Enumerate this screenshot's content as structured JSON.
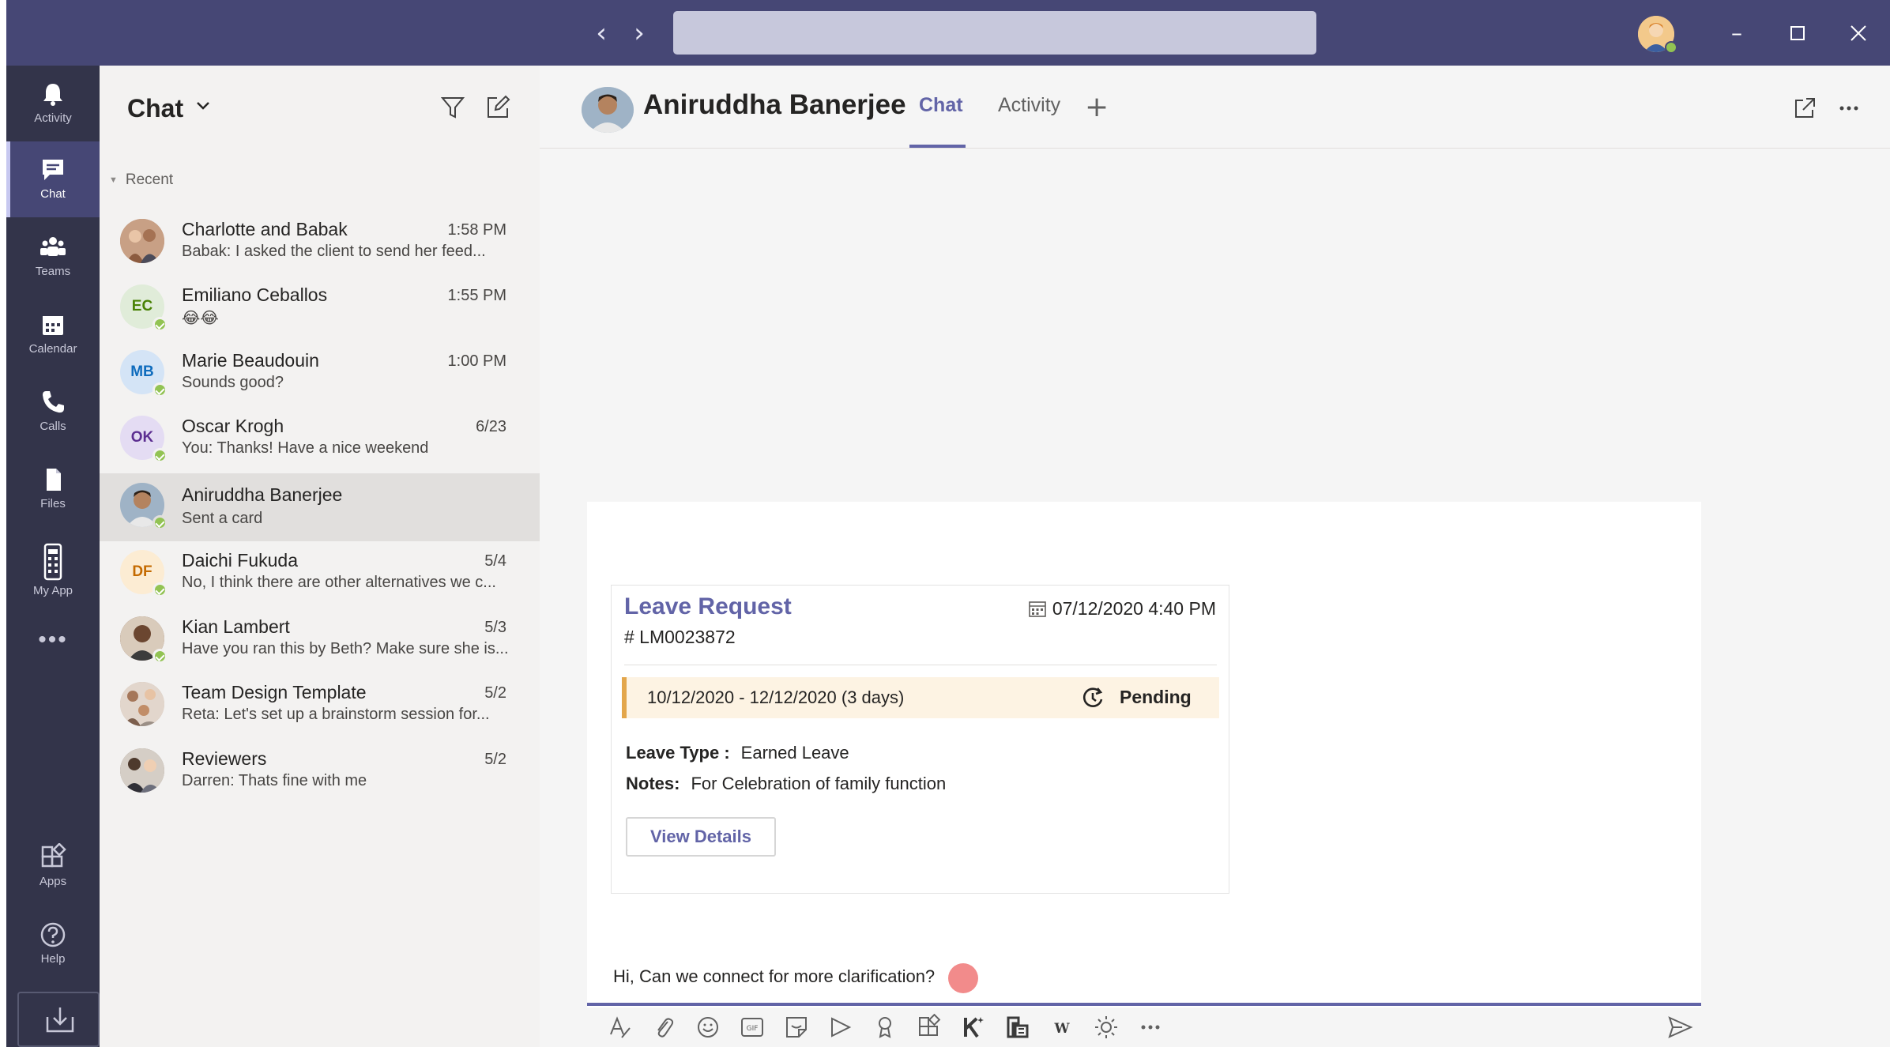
{
  "window": {
    "controls": {
      "minimize": "–",
      "maximize": "☐",
      "close": "✕"
    },
    "nav": {
      "back": "‹",
      "forward": "›"
    }
  },
  "rail": {
    "items": [
      {
        "label": "Activity",
        "icon": "bell-icon"
      },
      {
        "label": "Chat",
        "icon": "chat-icon",
        "active": true
      },
      {
        "label": "Teams",
        "icon": "teams-icon"
      },
      {
        "label": "Calendar",
        "icon": "calendar-icon"
      },
      {
        "label": "Calls",
        "icon": "phone-icon"
      },
      {
        "label": "Files",
        "icon": "file-icon"
      },
      {
        "label": "My App",
        "icon": "myapp-icon"
      }
    ],
    "more": "•••",
    "bottom": [
      {
        "label": "Apps",
        "icon": "apps-icon"
      },
      {
        "label": "Help",
        "icon": "help-icon"
      }
    ]
  },
  "chat_list": {
    "title": "Chat",
    "section": "Recent",
    "items": [
      {
        "name": "Charlotte and Babak",
        "time": "1:58 PM",
        "preview": "Babak: I asked the client to send her feed...",
        "avatar": "photo"
      },
      {
        "name": "Emiliano Ceballos",
        "time": "1:55 PM",
        "preview": "😂😂",
        "initials": "EC",
        "avatar_color": "#e0ecd9",
        "initials_color": "#498205"
      },
      {
        "name": "Marie Beaudouin",
        "time": "1:00 PM",
        "preview": "Sounds good?",
        "initials": "MB",
        "avatar_color": "#d4e4f6",
        "initials_color": "#0f6cbd"
      },
      {
        "name": "Oscar Krogh",
        "time": "6/23",
        "preview": "You: Thanks! Have a nice weekend",
        "initials": "OK",
        "avatar_color": "#e4dcf3",
        "initials_color": "#5c2e91"
      },
      {
        "name": "Aniruddha Banerjee",
        "time": "",
        "preview": "Sent a card",
        "avatar": "photo",
        "selected": true
      },
      {
        "name": "Daichi Fukuda",
        "time": "5/4",
        "preview": "No, I think there are other alternatives we c...",
        "initials": "DF",
        "avatar_color": "#fcecd3",
        "initials_color": "#c46a00"
      },
      {
        "name": "Kian Lambert",
        "time": "5/3",
        "preview": "Have you ran this by Beth? Make sure she is...",
        "avatar": "photo"
      },
      {
        "name": "Team Design Template",
        "time": "5/2",
        "preview": "Reta: Let's set up a brainstorm session for...",
        "avatar": "photo"
      },
      {
        "name": "Reviewers",
        "time": "5/2",
        "preview": "Darren: Thats fine with me",
        "avatar": "photo"
      }
    ]
  },
  "conversation": {
    "peer_name": "Aniruddha Banerjee",
    "tabs": [
      {
        "label": "Chat",
        "active": true
      },
      {
        "label": "Activity"
      }
    ],
    "add_tab": "+",
    "card": {
      "title": "Leave Request",
      "date": "07/12/2020 4:40 PM",
      "id": "# LM0023872",
      "range": "10/12/2020  - 12/12/2020 (3 days)",
      "status": "Pending",
      "leave_type_label": "Leave Type :",
      "leave_type": "Earned Leave",
      "notes_label": "Notes:",
      "notes": "For Celebration of family function",
      "button": "View Details"
    },
    "compose_text": "Hi, Can we connect for more clarification?"
  },
  "colors": {
    "titlebar": "#464775",
    "rail": "#33344a",
    "accent": "#6264a7",
    "presence": "#92c353",
    "pending_band": "#fdf3e3"
  }
}
